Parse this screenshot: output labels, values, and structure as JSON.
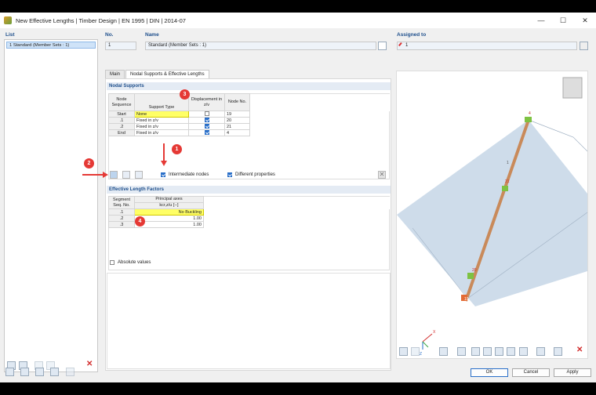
{
  "window": {
    "title": "New Effective Lengths | Timber Design | EN 1995 | DIN | 2014-07",
    "minimize": "—",
    "maximize": "☐",
    "close": "✕"
  },
  "list": {
    "label": "List",
    "items": [
      "1  Standard (Member Sets : 1)"
    ]
  },
  "header": {
    "no_label": "No.",
    "no_value": "1",
    "name_label": "Name",
    "name_value": "Standard (Member Sets : 1)",
    "assigned_label": "Assigned to",
    "assigned_value": "1"
  },
  "tabs": [
    "Main",
    "Nodal Supports & Effective Lengths"
  ],
  "nodal_supports": {
    "title": "Nodal Supports",
    "col_node_sequence": "Node Sequence",
    "col_support_type": "Support Type",
    "col_displacement": "Displacement in z/v",
    "col_node_no": "Node No.",
    "rows": [
      {
        "seq": "Start",
        "type": "None",
        "disp": false,
        "node": "19"
      },
      {
        "seq": ".1",
        "type": "Fixed in z/v",
        "disp": true,
        "node": "20"
      },
      {
        "seq": ".2",
        "type": "Fixed in z/v",
        "disp": true,
        "node": "21"
      },
      {
        "seq": "End",
        "type": "Fixed in z/v",
        "disp": true,
        "node": "4"
      }
    ],
    "intermediate_nodes": "Intermediate nodes",
    "different_properties": "Different properties"
  },
  "effective_length_factors": {
    "title": "Effective Length Factors",
    "col_segment": "Segment Seq. No.",
    "col_principal": "Principal axes",
    "col_kcr": "kcr,z/u [--]",
    "rows": [
      {
        "seq": ".1",
        "value": "No Buckling"
      },
      {
        "seq": ".2",
        "value": "1.00"
      },
      {
        "seq": ".3",
        "value": "1.00"
      }
    ],
    "absolute_values": "Absolute values"
  },
  "callouts": [
    "1",
    "2",
    "3",
    "4"
  ],
  "model": {
    "node_labels": [
      "4",
      "21",
      "20",
      "19"
    ],
    "axis_labels": [
      "X",
      "Z"
    ],
    "member_label": "1"
  },
  "footer": {
    "ok": "OK",
    "cancel": "Cancel",
    "apply": "Apply"
  },
  "colors": {
    "accent": "#2a6fc9",
    "callout": "#e53935",
    "highlight": "#ffff66",
    "member": "#c98a5a",
    "support": "#7ec242"
  }
}
